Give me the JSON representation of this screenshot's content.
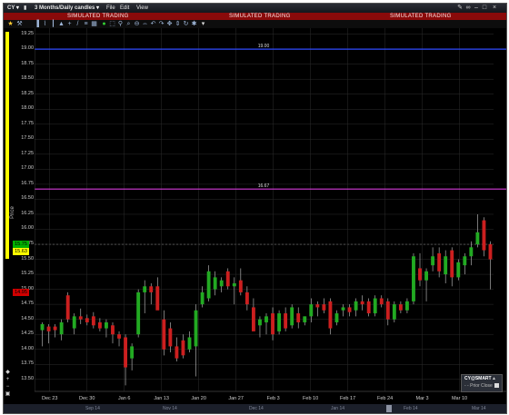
{
  "window": {
    "symbol": "CY",
    "chart_type": "3 Months/Daily candles",
    "menu": [
      "File",
      "Edit",
      "View"
    ],
    "simulated_label": "SIMULATED TRADING"
  },
  "axis": {
    "ylabel": "Price",
    "yticks": [
      "19.25",
      "19.00",
      "18.75",
      "18.50",
      "18.25",
      "18.00",
      "17.75",
      "17.50",
      "17.25",
      "17.00",
      "16.75",
      "16.50",
      "16.25",
      "16.00",
      "15.75",
      "15.50",
      "15.25",
      "15.00",
      "14.75",
      "14.50",
      "14.25",
      "14.00",
      "13.75",
      "13.50"
    ],
    "xticks": [
      "Dec 23",
      "Dec 30",
      "Jan 6",
      "Jan 13",
      "Jan 20",
      "Jan 27",
      "Feb 3",
      "Feb 10",
      "Feb 17",
      "Feb 24",
      "Mar 3",
      "Mar 10"
    ]
  },
  "hlines": [
    {
      "label": "19.00",
      "value": 19.0,
      "color": "#2f4bff"
    },
    {
      "label": "16.67",
      "value": 16.67,
      "color": "#d43bd8"
    }
  ],
  "price_tags": [
    {
      "label": "15.75",
      "color": "#00b000"
    },
    {
      "label": "15.63",
      "color": "#ffff00"
    },
    {
      "label": "14.95",
      "color": "#d00000"
    }
  ],
  "legend": {
    "title": "CY@SMART",
    "series": "Prior Close"
  },
  "bottom_labels": [
    "Sep 14",
    "Nov 14",
    "Dec 14",
    "Jan 14",
    "Feb 14",
    "Mar 14"
  ],
  "colors": {
    "up": "#22aa22",
    "down": "#cc1f1f",
    "wick": "#c8c8c8",
    "grid": "#2c2c2c"
  },
  "chart_data": {
    "type": "candlestick",
    "ylim": [
      13.3,
      19.35
    ],
    "ylabel": "Price",
    "candles": [
      {
        "o": 14.32,
        "h": 14.45,
        "l": 14.05,
        "c": 14.42
      },
      {
        "o": 14.38,
        "h": 14.42,
        "l": 14.1,
        "c": 14.3
      },
      {
        "o": 14.38,
        "h": 14.42,
        "l": 14.2,
        "c": 14.32
      },
      {
        "o": 14.25,
        "h": 14.5,
        "l": 14.15,
        "c": 14.45
      },
      {
        "o": 14.9,
        "h": 14.95,
        "l": 14.45,
        "c": 14.5
      },
      {
        "o": 14.35,
        "h": 14.6,
        "l": 14.25,
        "c": 14.55
      },
      {
        "o": 14.55,
        "h": 14.68,
        "l": 14.42,
        "c": 14.5
      },
      {
        "o": 14.52,
        "h": 14.58,
        "l": 14.4,
        "c": 14.45
      },
      {
        "o": 14.55,
        "h": 14.62,
        "l": 14.35,
        "c": 14.4
      },
      {
        "o": 14.45,
        "h": 14.52,
        "l": 14.3,
        "c": 14.35
      },
      {
        "o": 14.35,
        "h": 14.5,
        "l": 14.2,
        "c": 14.45
      },
      {
        "o": 14.4,
        "h": 14.45,
        "l": 14.1,
        "c": 14.25
      },
      {
        "o": 14.25,
        "h": 14.3,
        "l": 14.05,
        "c": 14.18
      },
      {
        "o": 14.2,
        "h": 14.25,
        "l": 13.4,
        "c": 13.7
      },
      {
        "o": 13.85,
        "h": 14.1,
        "l": 13.65,
        "c": 14.05
      },
      {
        "o": 14.25,
        "h": 15.0,
        "l": 14.2,
        "c": 14.95
      },
      {
        "o": 14.95,
        "h": 15.15,
        "l": 14.6,
        "c": 15.05
      },
      {
        "o": 15.05,
        "h": 15.1,
        "l": 14.75,
        "c": 14.95
      },
      {
        "o": 15.05,
        "h": 15.2,
        "l": 14.8,
        "c": 14.65
      },
      {
        "o": 14.5,
        "h": 14.65,
        "l": 13.9,
        "c": 14.0
      },
      {
        "o": 14.35,
        "h": 14.45,
        "l": 13.95,
        "c": 14.05
      },
      {
        "o": 14.05,
        "h": 14.2,
        "l": 13.8,
        "c": 13.85
      },
      {
        "o": 14.15,
        "h": 14.25,
        "l": 13.85,
        "c": 13.9
      },
      {
        "o": 14.0,
        "h": 14.3,
        "l": 13.95,
        "c": 14.2
      },
      {
        "o": 14.05,
        "h": 14.75,
        "l": 13.55,
        "c": 14.65
      },
      {
        "o": 14.75,
        "h": 15.05,
        "l": 14.7,
        "c": 14.95
      },
      {
        "o": 14.85,
        "h": 15.4,
        "l": 14.8,
        "c": 15.3
      },
      {
        "o": 15.0,
        "h": 15.3,
        "l": 14.9,
        "c": 15.2
      },
      {
        "o": 15.05,
        "h": 15.2,
        "l": 14.95,
        "c": 15.15
      },
      {
        "o": 15.3,
        "h": 15.35,
        "l": 15.0,
        "c": 15.05
      },
      {
        "o": 15.05,
        "h": 15.2,
        "l": 14.75,
        "c": 15.1
      },
      {
        "o": 15.15,
        "h": 15.35,
        "l": 14.9,
        "c": 14.95
      },
      {
        "o": 14.95,
        "h": 15.05,
        "l": 14.65,
        "c": 14.75
      },
      {
        "o": 14.7,
        "h": 14.85,
        "l": 14.45,
        "c": 14.3
      },
      {
        "o": 14.4,
        "h": 14.55,
        "l": 14.2,
        "c": 14.5
      },
      {
        "o": 14.45,
        "h": 14.6,
        "l": 14.25,
        "c": 14.55
      },
      {
        "o": 14.6,
        "h": 14.7,
        "l": 14.15,
        "c": 14.25
      },
      {
        "o": 14.3,
        "h": 14.65,
        "l": 14.25,
        "c": 14.6
      },
      {
        "o": 14.6,
        "h": 14.7,
        "l": 14.3,
        "c": 14.35
      },
      {
        "o": 14.4,
        "h": 14.75,
        "l": 14.35,
        "c": 14.7
      },
      {
        "o": 14.6,
        "h": 14.7,
        "l": 14.35,
        "c": 14.45
      },
      {
        "o": 14.45,
        "h": 14.55,
        "l": 14.4,
        "c": 14.55
      },
      {
        "o": 14.55,
        "h": 14.85,
        "l": 14.45,
        "c": 14.75
      },
      {
        "o": 14.75,
        "h": 14.8,
        "l": 14.55,
        "c": 14.7
      },
      {
        "o": 14.75,
        "h": 14.85,
        "l": 14.6,
        "c": 14.65
      },
      {
        "o": 14.8,
        "h": 14.85,
        "l": 14.25,
        "c": 14.35
      },
      {
        "o": 14.45,
        "h": 14.65,
        "l": 14.4,
        "c": 14.6
      },
      {
        "o": 14.65,
        "h": 14.75,
        "l": 14.55,
        "c": 14.7
      },
      {
        "o": 14.7,
        "h": 14.75,
        "l": 14.55,
        "c": 14.62
      },
      {
        "o": 14.65,
        "h": 14.85,
        "l": 14.55,
        "c": 14.8
      },
      {
        "o": 14.8,
        "h": 14.9,
        "l": 14.65,
        "c": 14.75
      },
      {
        "o": 14.8,
        "h": 14.85,
        "l": 14.55,
        "c": 14.6
      },
      {
        "o": 14.6,
        "h": 14.9,
        "l": 14.55,
        "c": 14.85
      },
      {
        "o": 14.85,
        "h": 14.9,
        "l": 14.7,
        "c": 14.75
      },
      {
        "o": 14.8,
        "h": 14.85,
        "l": 14.4,
        "c": 14.5
      },
      {
        "o": 14.5,
        "h": 14.8,
        "l": 14.45,
        "c": 14.75
      },
      {
        "o": 14.75,
        "h": 14.8,
        "l": 14.6,
        "c": 14.65
      },
      {
        "o": 14.65,
        "h": 14.85,
        "l": 14.6,
        "c": 14.8
      },
      {
        "o": 14.8,
        "h": 15.6,
        "l": 14.75,
        "c": 15.55
      },
      {
        "o": 15.35,
        "h": 15.6,
        "l": 15.05,
        "c": 15.15
      },
      {
        "o": 15.15,
        "h": 15.35,
        "l": 14.8,
        "c": 15.3
      },
      {
        "o": 15.4,
        "h": 15.7,
        "l": 15.3,
        "c": 15.55
      },
      {
        "o": 15.6,
        "h": 15.7,
        "l": 15.2,
        "c": 15.3
      },
      {
        "o": 15.25,
        "h": 15.65,
        "l": 15.1,
        "c": 15.55
      },
      {
        "o": 15.65,
        "h": 15.7,
        "l": 15.05,
        "c": 15.2
      },
      {
        "o": 15.2,
        "h": 15.5,
        "l": 15.15,
        "c": 15.45
      },
      {
        "o": 15.4,
        "h": 15.6,
        "l": 15.25,
        "c": 15.55
      },
      {
        "o": 15.55,
        "h": 15.8,
        "l": 15.4,
        "c": 15.7
      },
      {
        "o": 15.75,
        "h": 16.25,
        "l": 15.7,
        "c": 15.95
      },
      {
        "o": 16.15,
        "h": 16.2,
        "l": 15.55,
        "c": 15.65
      },
      {
        "o": 15.75,
        "h": 15.8,
        "l": 15.0,
        "c": 15.5
      }
    ]
  }
}
